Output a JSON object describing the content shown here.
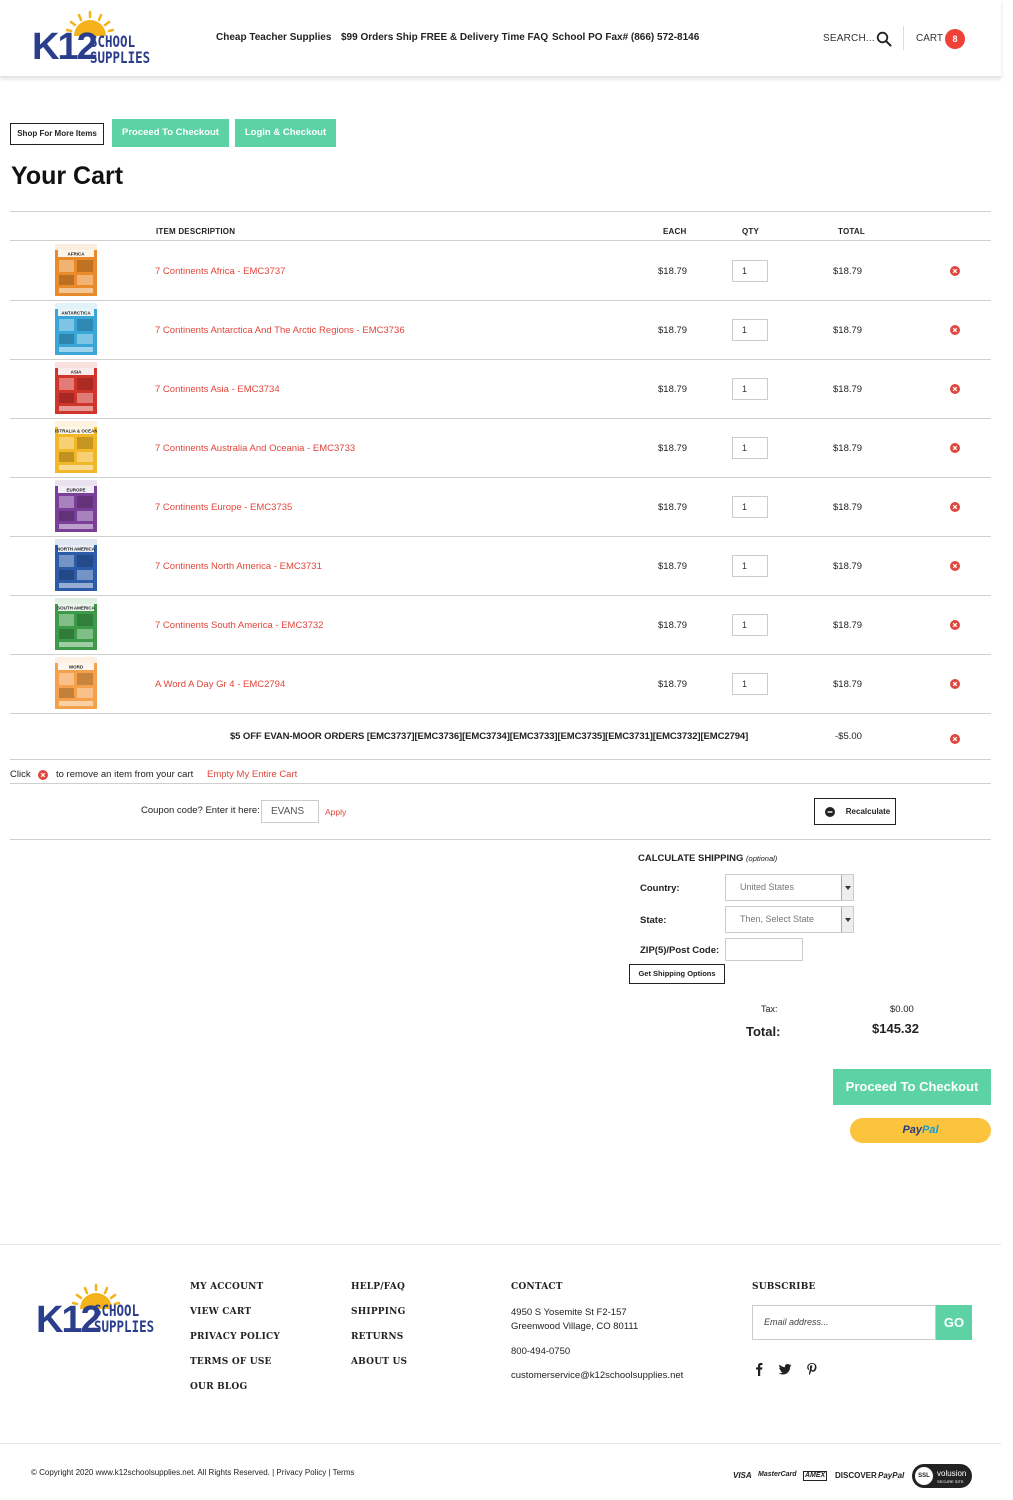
{
  "header": {
    "logo": {
      "k12": "K12",
      "school": "SCHOOL",
      "supplies": "SUPPLIES"
    },
    "nav": [
      {
        "label": "Cheap Teacher Supplies"
      },
      {
        "label": "$99 Orders Ship FREE & Delivery Time FAQ"
      },
      {
        "label": "School PO Fax# (866) 572-8146"
      }
    ],
    "search_label": "SEARCH...",
    "cart_label": "CART",
    "cart_count": "8"
  },
  "actions": {
    "shop_more": "Shop For More Items",
    "proceed_checkout": "Proceed To Checkout",
    "login_checkout": "Login & Checkout"
  },
  "page_title": "Your Cart",
  "table": {
    "headers": {
      "description": "ITEM DESCRIPTION",
      "each": "EACH",
      "qty": "QTY",
      "total": "TOTAL"
    },
    "items": [
      {
        "name": "7 Continents Africa - EMC3737",
        "each": "$18.79",
        "qty": "1",
        "total": "$18.79",
        "cover_label": "AFRICA",
        "cover_color": "#e98b2a"
      },
      {
        "name": "7 Continents Antarctica And The Arctic Regions - EMC3736",
        "each": "$18.79",
        "qty": "1",
        "total": "$18.79",
        "cover_label": "ANTARCTICA",
        "cover_color": "#3aa6d8"
      },
      {
        "name": "7 Continents Asia - EMC3734",
        "each": "$18.79",
        "qty": "1",
        "total": "$18.79",
        "cover_label": "ASIA",
        "cover_color": "#d0352c"
      },
      {
        "name": "7 Continents Australia And Oceania - EMC3733",
        "each": "$18.79",
        "qty": "1",
        "total": "$18.79",
        "cover_label": "AUSTRALIA & OCEANIA",
        "cover_color": "#f2b728"
      },
      {
        "name": "7 Continents Europe - EMC3735",
        "each": "$18.79",
        "qty": "1",
        "total": "$18.79",
        "cover_label": "EUROPE",
        "cover_color": "#7a3f98"
      },
      {
        "name": "7 Continents North America - EMC3731",
        "each": "$18.79",
        "qty": "1",
        "total": "$18.79",
        "cover_label": "NORTH AMERICA",
        "cover_color": "#2c5ba8"
      },
      {
        "name": "7 Continents South America - EMC3732",
        "each": "$18.79",
        "qty": "1",
        "total": "$18.79",
        "cover_label": "SOUTH AMERICA",
        "cover_color": "#3d9a48"
      },
      {
        "name": "A Word A Day Gr 4 - EMC2794",
        "each": "$18.79",
        "qty": "1",
        "total": "$18.79",
        "cover_label": "WORD",
        "cover_color": "#f5a04a"
      }
    ],
    "discount": {
      "label": "$5 OFF EVAN-MOOR ORDERS [EMC3737][EMC3736][EMC3734][EMC3733][EMC3735][EMC3731][EMC3732][EMC2794]",
      "amount": "-$5.00"
    }
  },
  "remove_hint": {
    "prefix": "Click",
    "suffix": "to remove an item from your cart",
    "empty_link": "Empty My Entire Cart"
  },
  "coupon": {
    "label": "Coupon code? Enter it here:",
    "value": "EVANS",
    "apply": "Apply",
    "recalculate": "Recalculate"
  },
  "shipping": {
    "title": "CALCULATE SHIPPING",
    "optional": "(optional)",
    "country_label": "Country:",
    "country_value": "United States",
    "state_label": "State:",
    "state_value": "Then, Select State",
    "zip_label": "ZIP(5)/Post Code:",
    "button": "Get Shipping Options"
  },
  "summary": {
    "tax_label": "Tax:",
    "tax_value": "$0.00",
    "total_label": "Total:",
    "total_value": "$145.32"
  },
  "checkout_button": "Proceed To Checkout",
  "paypal": {
    "pay": "Pay",
    "pal": "Pal"
  },
  "footer": {
    "col1": [
      "MY ACCOUNT",
      "VIEW CART",
      "PRIVACY POLICY",
      "TERMS OF USE",
      "OUR BLOG"
    ],
    "col2": [
      "HELP/FAQ",
      "SHIPPING",
      "RETURNS",
      "ABOUT US"
    ],
    "contact_title": "CONTACT",
    "address_line1": "4950 S Yosemite St F2-157",
    "address_line2": "Greenwood Village, CO 80111",
    "phone": "800-494-0750",
    "email": "customerservice@k12schoolsupplies.net",
    "subscribe_title": "SUBSCRIBE",
    "email_placeholder": "Email address...",
    "go": "GO",
    "copyright": "© Copyright 2020 www.k12schoolsupplies.net. All Rights Reserved. | Privacy Policy | Terms",
    "payment_methods": [
      "VISA",
      "MasterCard",
      "AMEX",
      "DISCOVER",
      "PayPal"
    ],
    "ssl_badge": {
      "ssl": "SSL",
      "brand": "volusion",
      "sub": "SECURE SITE"
    }
  },
  "colors": {
    "brand_blue": "#2b3e8c",
    "accent_green": "#5dd3a5",
    "link_red": "#e0463b",
    "badge_red": "#ef4135",
    "paypal_yellow": "#fbc43c"
  }
}
